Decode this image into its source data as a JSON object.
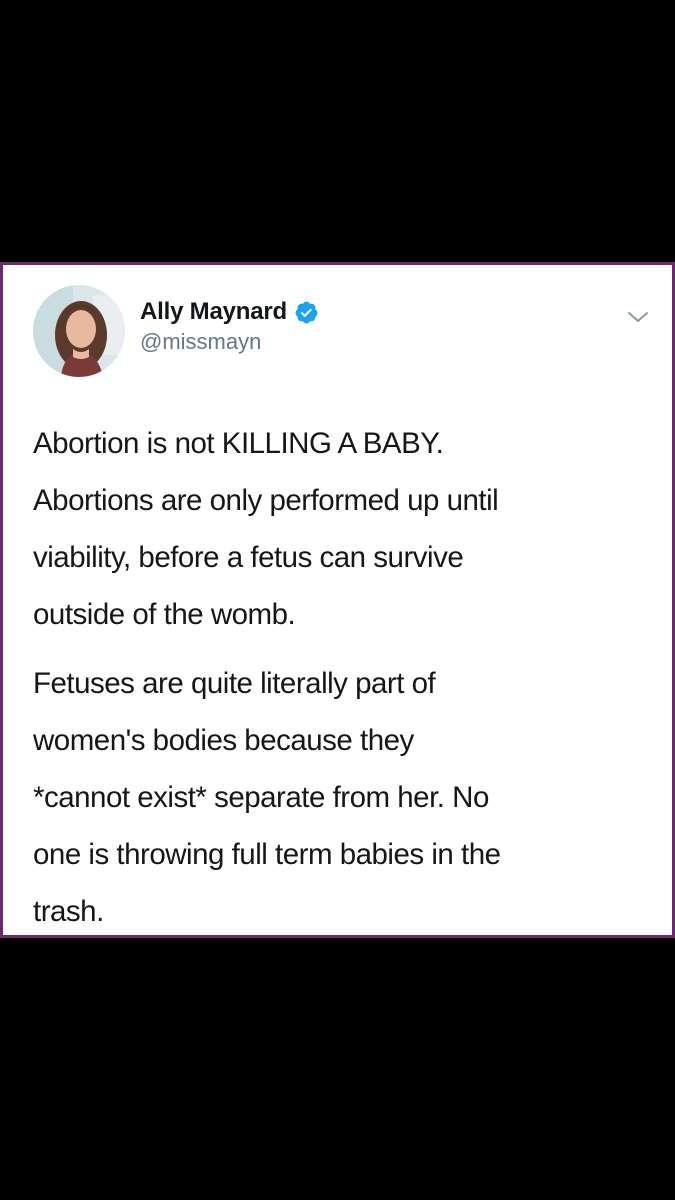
{
  "tweet": {
    "author": {
      "display_name": "Ally Maynard",
      "handle": "@missmayn",
      "verified": true,
      "avatar_icon": "profile-photo"
    },
    "menu_icon": "chevron-down-icon",
    "paragraphs": [
      {
        "lines": [
          "Abortion is not KILLING A BABY.",
          "Abortions are only performed up until",
          "viability, before a fetus can survive",
          "outside of the womb."
        ]
      },
      {
        "lines": [
          "Fetuses are quite literally part of",
          "women's bodies because they",
          "*cannot exist* separate from her. No",
          "one is throwing full term babies in the",
          "trash."
        ]
      }
    ]
  },
  "colors": {
    "background": "#000000",
    "card": "#ffffff",
    "card_border": "#6b2a6e",
    "verified_blue": "#1da1f2",
    "text": "#14171a",
    "secondary_text": "#657786"
  }
}
